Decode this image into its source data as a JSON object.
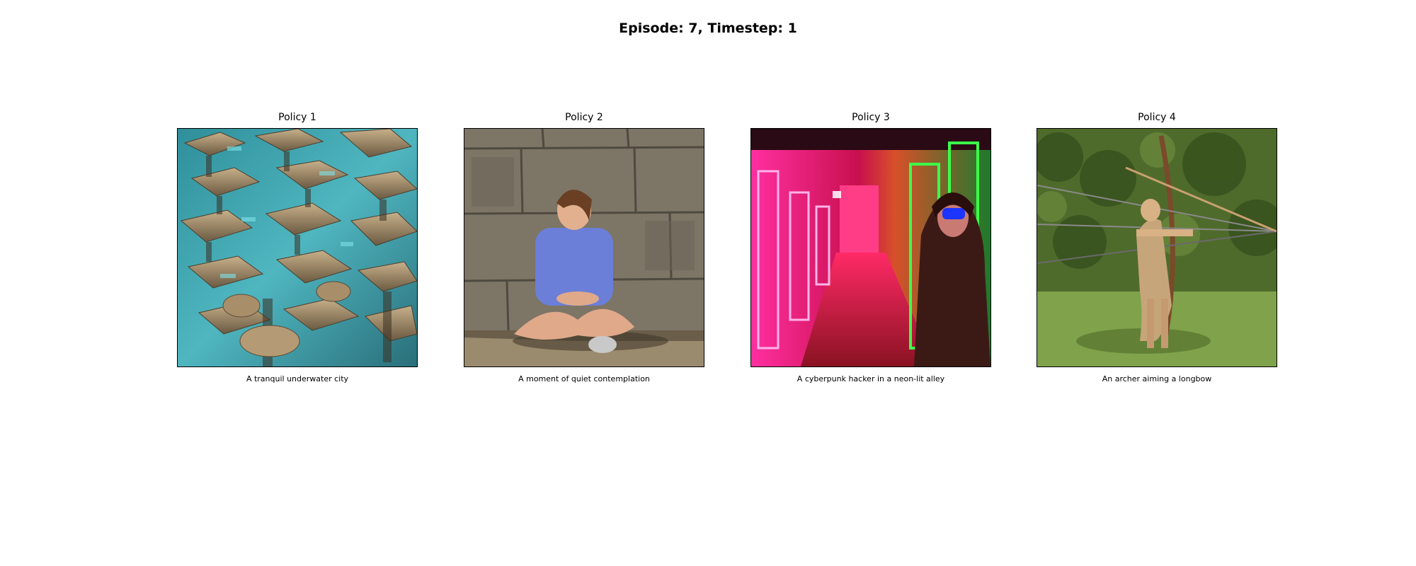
{
  "figure": {
    "suptitle": "Episode: 7, Timestep: 1"
  },
  "panels": [
    {
      "title": "Policy 1",
      "caption": "A tranquil underwater city",
      "image_subject": "isometric underwater city with teal water and sand-colored buildings"
    },
    {
      "title": "Policy 2",
      "caption": "A moment of quiet contemplation",
      "image_subject": "woman in blue shirt sitting cross-legged against a stone wall"
    },
    {
      "title": "Policy 3",
      "caption": "A cyberpunk hacker in a neon-lit alley",
      "image_subject": "hooded figure in a pink and green neon-lit alley"
    },
    {
      "title": "Policy 4",
      "caption": "An archer aiming a longbow",
      "image_subject": "archer drawing a longbow in a green grassy field"
    }
  ],
  "colors": {
    "background": "#ffffff",
    "text": "#000000",
    "image_border": "#000000",
    "underwater_teal": "#3aa7b4",
    "stone_gray": "#7d7566",
    "neon_pink": "#ff1f8e",
    "neon_green": "#22ff3c",
    "foliage_green": "#4f6b2c"
  }
}
